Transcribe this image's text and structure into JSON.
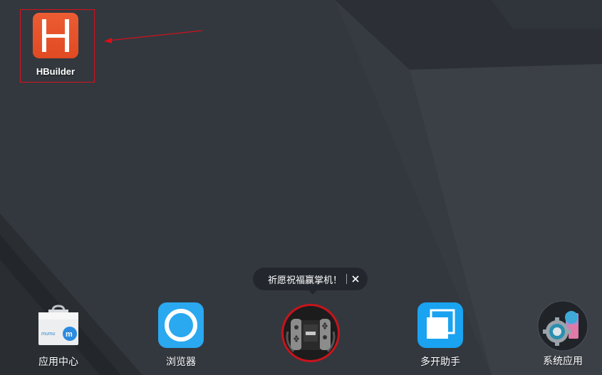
{
  "desktop": {
    "icons": [
      {
        "label": "HBuilder",
        "icon": "hbuilder-icon",
        "color": "#e8532b"
      }
    ],
    "highlight_color": "#d8101a"
  },
  "tooltip": {
    "text": "祈愿祝福赢掌机！",
    "close_icon": "close-icon"
  },
  "dock": {
    "items": [
      {
        "label": "应用中心",
        "icon": "app-center-icon",
        "badge_text": "mumu"
      },
      {
        "label": "浏览器",
        "icon": "browser-icon",
        "color": "#2aa8f0"
      },
      {
        "label": "",
        "icon": "game-console-icon"
      },
      {
        "label": "多开助手",
        "icon": "multi-instance-icon",
        "color": "#1aa3f0"
      },
      {
        "label": "系统应用",
        "icon": "system-apps-icon"
      }
    ]
  },
  "colors": {
    "wallpaper": "#353a41",
    "tooltip_bg": "#23272d"
  }
}
